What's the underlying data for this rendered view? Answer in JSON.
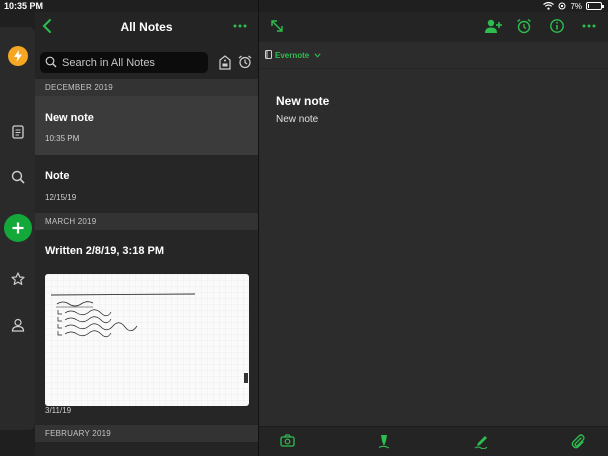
{
  "status": {
    "time": "10:35 PM",
    "battery": "7%",
    "battery_level": 0.07
  },
  "list": {
    "title": "All Notes",
    "search_placeholder": "Search in All Notes",
    "sections": [
      {
        "label": "DECEMBER 2019"
      },
      {
        "label": "MARCH 2019"
      },
      {
        "label": "FEBRUARY 2019"
      }
    ],
    "notes": [
      {
        "title": "New note",
        "date": "10:35 PM",
        "selected": true
      },
      {
        "title": "Note",
        "date": "12/15/19",
        "selected": false
      },
      {
        "title": "Written 2/8/19, 3:18 PM",
        "date": "3/11/19",
        "selected": false,
        "has_thumbnail": true
      }
    ]
  },
  "editor": {
    "notebook": "Evernote",
    "note_title": "New note",
    "note_body": "New note"
  },
  "colors": {
    "accent": "#2dbe4e",
    "lightning": "#f5a623",
    "add_button": "#14a83b"
  }
}
